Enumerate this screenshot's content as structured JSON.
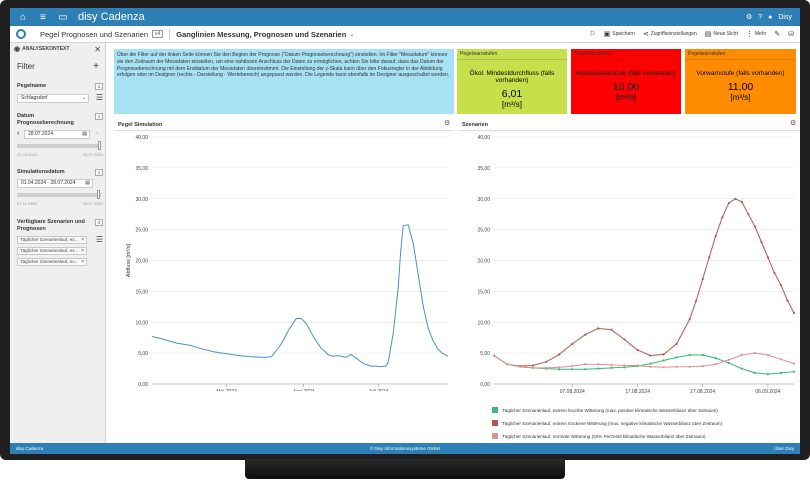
{
  "app": {
    "title": "disy Cadenza",
    "user": "Disy"
  },
  "subbar": {
    "breadcrumb": "Pegel Prognosen und Szenarien",
    "badge": "v4",
    "view_title": "Ganglinien Messung, Prognosen und Szenarien",
    "tools": {
      "save": "Speichern",
      "access": "Zugriffseinstellungen",
      "new_view": "Neue Sicht",
      "more": "Mehr"
    }
  },
  "sidebar": {
    "header": "ANALYSEKONTEXT",
    "filter_title": "Filter",
    "pegelname": {
      "label": "Pegelname",
      "count": "1",
      "value": "Schlagsdorf"
    },
    "datum": {
      "label": "Datum Prognoseberechnung",
      "count": "1",
      "value": "28.07.2024",
      "min": "22.03.2024",
      "max": "28.07.2024",
      "level": 1.0
    },
    "simulationsdatum": {
      "label": "Simulationsdatum",
      "count": "1",
      "value": "01.04.2024 - 28.07.2024",
      "min": "01.11.1989",
      "max": "28.07.2024",
      "level": 0.99
    },
    "szenarien": {
      "label": "Verfügbare Szenarien und Prognosen",
      "count": "3",
      "chips": [
        "Täglicher Szenarienlauf, ex...",
        "Täglicher Szenarienlauf, ex...",
        "Täglicher Szenarienlauf, no..."
      ]
    }
  },
  "info_text": "Über die Filter auf der linken Seite können Sie den Beginn der Prognose (\"Datum Prognoseberechnung\") einstellen. Im Filter \"Messdatum\" können sie den Zeitraum der Messdaten einstellen, um eine nahtlosen Anschluss der Daten zu ermöglichen, achten Sie bitte darauf, dass das Datum der Prognoseberechnung mit dem Enddatum der Messdaten übereinstimmt. Die Einstellung der y-Skala kann über den Fokusregler in der Abbildung erfolgen oder im Designer (rechts - Darstellung - Wertebereich) angepasst werden. Die Legende kann ebenfalls im Designer ausgeschaltet werden.",
  "cards": [
    {
      "title": "Pegelwarnstufen",
      "subtitle": "Ökol. Mindestdurchfluss (falls vorhanden)",
      "value": "6,01",
      "unit": "[m³/s]",
      "color": "#c5e04a"
    },
    {
      "title": "Pegelwarnstufen",
      "subtitle": "Hochwasserstufe (falls vorhanden)",
      "value": "10,00",
      "unit": "[m³/s]",
      "color": "#ff0000"
    },
    {
      "title": "Pegelwarnstufen",
      "subtitle": "Vorwarnstufe (falls vorhanden)",
      "value": "11,00",
      "unit": "[m³/s]",
      "color": "#ff8c00"
    }
  ],
  "panels": {
    "sim_title": "Pegel Simulation",
    "scen_title": "Szenarien"
  },
  "footer": {
    "left": "disy Cadenza",
    "center": "© Disy Informationssysteme GmbH",
    "right": "Über Disy"
  },
  "chart_data": [
    {
      "type": "line",
      "title": "Pegel Simulation",
      "ylabel": "Abfluss [m³/s]",
      "ylim": [
        0,
        40
      ],
      "yticks": [
        "0,00",
        "5,00",
        "10,00",
        "15,00",
        "20,00",
        "25,00",
        "30,00",
        "35,00",
        "40,00"
      ],
      "xticks": [
        {
          "label": "Mai 2024",
          "x": 30
        },
        {
          "label": "Juni 2024",
          "x": 61
        },
        {
          "label": "Juli 2024",
          "x": 91
        }
      ],
      "xlim": [
        0,
        119
      ],
      "grid": true,
      "color": "#4a90d0",
      "series": [
        {
          "x": [
            0,
            5,
            10,
            15,
            20,
            25,
            30,
            35,
            40,
            45,
            48,
            52,
            55,
            58,
            60,
            62,
            65,
            68,
            70,
            71,
            73,
            75,
            78,
            80,
            85,
            88,
            90,
            92,
            94,
            95,
            97,
            99,
            100,
            101,
            103,
            105,
            107,
            109,
            111,
            113,
            115,
            117,
            119
          ],
          "y": [
            7.7,
            7.2,
            6.6,
            6.3,
            5.7,
            5.2,
            4.9,
            4.6,
            4.4,
            4.3,
            4.4,
            6.5,
            8.8,
            10.6,
            10.6,
            9.8,
            7.6,
            5.8,
            5.1,
            4.7,
            4.5,
            4.6,
            4.3,
            4.8,
            3.3,
            2.9,
            2.9,
            2.8,
            2.9,
            3.6,
            8.3,
            15.8,
            21.5,
            25.6,
            25.8,
            22.8,
            17.7,
            12.7,
            9.1,
            7.0,
            5.6,
            4.9,
            4.5
          ]
        }
      ]
    },
    {
      "type": "line",
      "title": "Szenarien",
      "ylim": [
        0,
        40
      ],
      "yticks": [
        "0,00",
        "5,00",
        "10,00",
        "15,00",
        "20,00",
        "25,00",
        "30,00",
        "35,00",
        "40,00"
      ],
      "xticks": [
        {
          "label": "07.08.2024",
          "x": 10
        },
        {
          "label": "17.08.2024",
          "x": 20
        },
        {
          "label": "27.08.2024",
          "x": 30
        },
        {
          "label": "06.09.2024",
          "x": 40
        }
      ],
      "xlim": [
        -2,
        44
      ],
      "grid": true,
      "legend": "bottom",
      "series": [
        {
          "name": "Täglicher Szenarienlauf, extrem feuchte Witterung (max. positive klimatische Wasserbilanz über Zeitraum)",
          "color": "#3cb878",
          "x": [
            -2,
            0,
            2,
            4,
            6,
            8,
            10,
            12,
            14,
            16,
            18,
            20,
            22,
            24,
            26,
            28,
            30,
            32,
            34,
            36,
            38,
            40,
            42,
            44
          ],
          "y": [
            4.6,
            3.2,
            2.8,
            2.6,
            2.5,
            2.4,
            2.4,
            2.4,
            2.5,
            2.6,
            2.7,
            2.9,
            3.3,
            3.8,
            4.3,
            4.7,
            4.7,
            4.2,
            3.4,
            2.5,
            1.8,
            1.6,
            1.8,
            2.0
          ]
        },
        {
          "name": "Täglicher Szenarienlauf, extrem trockene Witterung (max. negative klimatische Wasserbilanz über Zeitraum)",
          "color": "#b05a4e",
          "x": [
            -2,
            0,
            2,
            4,
            6,
            8,
            10,
            12,
            14,
            16,
            18,
            20,
            22,
            24,
            26,
            28,
            29,
            30,
            31,
            32,
            33,
            34,
            35,
            36,
            37,
            38,
            39,
            40,
            41,
            42,
            43,
            44
          ],
          "y": [
            4.6,
            3.2,
            2.9,
            3.0,
            3.6,
            4.8,
            6.5,
            8.0,
            9.0,
            8.8,
            7.2,
            5.5,
            4.6,
            4.8,
            6.5,
            10.5,
            13.5,
            17.0,
            20.5,
            24.0,
            27.0,
            29.3,
            30.0,
            29.5,
            27.5,
            25.5,
            23.0,
            20.5,
            18.0,
            16.0,
            13.5,
            11.5
          ]
        },
        {
          "name": "Täglicher Szenarienlauf, normale Witterung (50% Perzentil klimatische Wasserbilanz über Zeitraum)",
          "color": "#e09090",
          "x": [
            -2,
            0,
            2,
            4,
            6,
            8,
            10,
            12,
            14,
            16,
            18,
            20,
            22,
            24,
            26,
            28,
            30,
            32,
            34,
            36,
            38,
            40,
            42,
            44
          ],
          "y": [
            4.6,
            3.2,
            2.8,
            2.6,
            2.6,
            2.7,
            2.9,
            3.2,
            3.2,
            3.1,
            3.0,
            3.0,
            2.8,
            2.7,
            2.8,
            2.8,
            2.9,
            3.2,
            3.9,
            4.7,
            5.0,
            4.7,
            4.0,
            3.3
          ]
        }
      ]
    }
  ]
}
